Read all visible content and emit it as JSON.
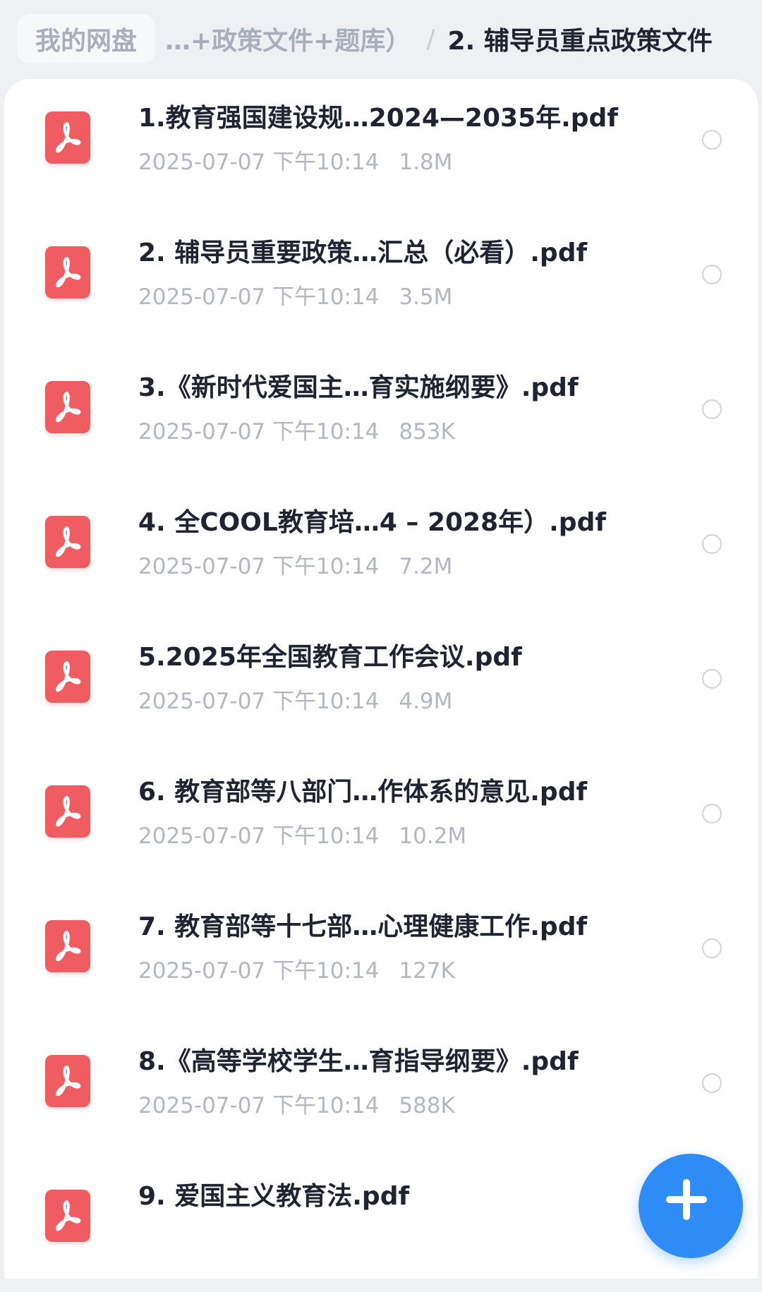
{
  "breadcrumb": {
    "root": "我的网盘",
    "middle": "…+政策文件+题库）",
    "separator": "/",
    "current": "2. 辅导员重点政策文件"
  },
  "files": [
    {
      "name": "1.教育强国建设规…2024—2035年.pdf",
      "time": "2025-07-07 下午10:14",
      "size": "1.8M"
    },
    {
      "name": "2. 辅导员重要政策…汇总（必看）.pdf",
      "time": "2025-07-07 下午10:14",
      "size": "3.5M"
    },
    {
      "name": "3.《新时代爱国主…育实施纲要》.pdf",
      "time": "2025-07-07 下午10:14",
      "size": "853K"
    },
    {
      "name": "4. 全COOL教育培…4 – 2028年）.pdf",
      "time": "2025-07-07 下午10:14",
      "size": "7.2M"
    },
    {
      "name": "5.2025年全国教育工作会议.pdf",
      "time": "2025-07-07 下午10:14",
      "size": "4.9M"
    },
    {
      "name": "6. 教育部等八部门…作体系的意见.pdf",
      "time": "2025-07-07 下午10:14",
      "size": "10.2M"
    },
    {
      "name": "7. 教育部等十七部…心理健康工作.pdf",
      "time": "2025-07-07 下午10:14",
      "size": "127K"
    },
    {
      "name": "8.《高等学校学生…育指导纲要》.pdf",
      "time": "2025-07-07 下午10:14",
      "size": "588K"
    },
    {
      "name": "9. 爱国主义教育法.pdf",
      "time": "",
      "size": ""
    }
  ],
  "colors": {
    "pdf_icon": "#ef5d63",
    "fab": "#2f8cf6",
    "title_text": "#1f2430",
    "meta_text": "#b3b7c0"
  },
  "icons": {
    "file": "pdf-icon",
    "select": "radio-circle",
    "fab": "plus-icon"
  }
}
